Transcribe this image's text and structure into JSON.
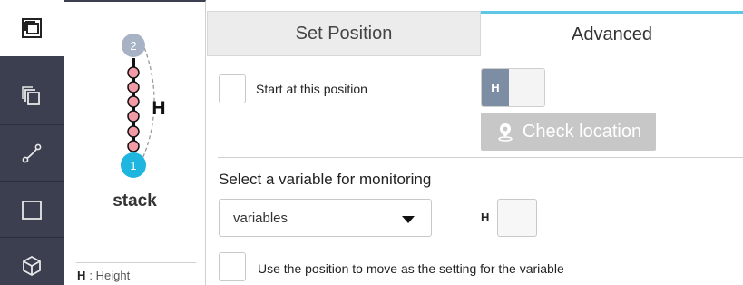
{
  "sidebar": {
    "tools": [
      {
        "name": "stack-tool",
        "icon": "stack-select-icon",
        "active": true
      },
      {
        "name": "layers-tool",
        "icon": "layers-icon",
        "active": false
      },
      {
        "name": "path-tool",
        "icon": "path-curve-icon",
        "active": false
      },
      {
        "name": "rectangle-tool",
        "icon": "square-icon",
        "active": false
      },
      {
        "name": "box-tool",
        "icon": "cube-icon",
        "active": false
      }
    ]
  },
  "diagram": {
    "top_node": "2",
    "bottom_node": "1",
    "dimension_letter": "H",
    "caption": "stack",
    "legend_key": "H",
    "legend_text": ": Height",
    "colors": {
      "bottom_node": "#1eb6df",
      "top_node": "#a7b3c5",
      "dots": "#f29aa6"
    }
  },
  "tabs": [
    {
      "label": "Set Position",
      "active": false
    },
    {
      "label": "Advanced",
      "active": true
    }
  ],
  "advanced": {
    "start_label": "Start at this position",
    "toggle_label": "H",
    "check_location_label": "Check location",
    "monitor_title": "Select a variable for monitoring",
    "variable_select": "variables",
    "h_field_label": "H",
    "h_field_value": "",
    "use_position_label": "Use the position to move as the setting for the variable",
    "accent_color": "#5ec7e6"
  }
}
